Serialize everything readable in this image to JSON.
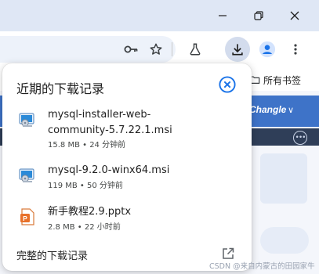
{
  "window": {
    "minimize_icon": "minimize-icon",
    "maximize_icon": "restore-icon",
    "close_icon": "close-icon"
  },
  "toolbar": {
    "icons": [
      "key-icon",
      "star-icon",
      "flask-icon",
      "download-icon",
      "profile-icon",
      "more-vert-icon"
    ],
    "accent": "#1a73e8"
  },
  "bookmarks": {
    "all_bookmarks_label": "所有书签"
  },
  "page": {
    "nav_label": "Changle",
    "nav_color": "#3e73c8"
  },
  "downloads": {
    "title": "近期的下载记录",
    "items": [
      {
        "name_line1": "mysql-installer-web-",
        "name_line2": "community-5.7.22.1.msi",
        "meta": "15.8 MB • 24 分钟前",
        "icon": "msi-installer-icon"
      },
      {
        "name_line1": "mysql-9.2.0-winx64.msi",
        "meta": "119 MB • 50 分钟前",
        "icon": "msi-installer-icon"
      },
      {
        "name_line1": "新手教程2.9.pptx",
        "meta": "2.8 MB • 22 小时前",
        "icon": "pptx-file-icon"
      }
    ],
    "footer_label": "完整的下载记录"
  },
  "watermark": "CSDN @来自内蒙古的田园家牛"
}
